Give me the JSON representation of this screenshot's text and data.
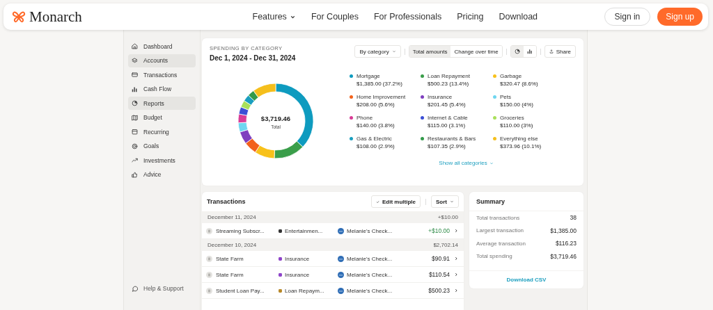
{
  "nav": {
    "brand": "Monarch",
    "links": [
      {
        "label": "Features",
        "dropdown": true
      },
      {
        "label": "For Couples",
        "dropdown": false
      },
      {
        "label": "For Professionals",
        "dropdown": false
      },
      {
        "label": "Pricing",
        "dropdown": false
      },
      {
        "label": "Download",
        "dropdown": false
      }
    ],
    "sign_in": "Sign in",
    "sign_up": "Sign up"
  },
  "sidebar": {
    "items": [
      {
        "label": "Dashboard",
        "selected": false
      },
      {
        "label": "Accounts",
        "selected": true
      },
      {
        "label": "Transactions",
        "selected": false
      },
      {
        "label": "Cash Flow",
        "selected": false
      },
      {
        "label": "Reports",
        "selected": true
      },
      {
        "label": "Budget",
        "selected": false
      },
      {
        "label": "Recurring",
        "selected": false
      },
      {
        "label": "Goals",
        "selected": false
      },
      {
        "label": "Investments",
        "selected": false
      },
      {
        "label": "Advice",
        "selected": false
      }
    ],
    "footer": "Help & Support"
  },
  "spending": {
    "eyebrow": "SPENDING BY CATEGORY",
    "date_range": "Dec 1, 2024 - Dec 31, 2024",
    "group_by": "By category",
    "modes": [
      {
        "label": "Total amounts",
        "selected": true
      },
      {
        "label": "Change over time",
        "selected": false
      }
    ],
    "views": [
      {
        "selected": true
      },
      {
        "selected": false
      }
    ],
    "share": "Share",
    "total": "$3,719.46",
    "total_label": "Total",
    "chart_data": {
      "type": "donut",
      "categories": [
        "Mortgage",
        "Loan Repayment",
        "Garbage",
        "Home Improvement",
        "Insurance",
        "Pets",
        "Phone",
        "Internet & Cable",
        "Groceries",
        "Gas & Electric",
        "Restaurants & Bars",
        "Everything else"
      ],
      "values": [
        37.2,
        13.4,
        8.6,
        5.6,
        5.4,
        4,
        3.8,
        3.1,
        3,
        2.9,
        2.9,
        10.1
      ]
    },
    "legend": [
      {
        "amount": "$1,385.00 (37.2%)",
        "color": "#0e9bbf"
      },
      {
        "amount": "$500.23 (13.4%)",
        "color": "#3a9e4a"
      },
      {
        "amount": "$320.47 (8.6%)",
        "color": "#f8c11a"
      },
      {
        "amount": "$208.00 (5.6%)",
        "color": "#f2621c"
      },
      {
        "amount": "$201.45 (5.4%)",
        "color": "#7f3fbf"
      },
      {
        "amount": "$150.00 (4%)",
        "color": "#6fd6f0"
      },
      {
        "amount": "$140.00 (3.8%)",
        "color": "#d93d96"
      },
      {
        "amount": "$115.00 (3.1%)",
        "color": "#3b4fd6"
      },
      {
        "amount": "$110.00 (3%)",
        "color": "#a9e05a"
      },
      {
        "amount": "$108.00 (2.9%)",
        "color": "#1a9fbf"
      },
      {
        "amount": "$107.35 (2.9%)",
        "color": "#329a4a"
      },
      {
        "amount": "$373.96 (10.1%)",
        "color": "#f5bf1c"
      }
    ],
    "show_all": "Show all categories"
  },
  "transactions": {
    "title": "Transactions",
    "edit": "Edit multiple",
    "sort": "Sort",
    "groups": [
      {
        "date": "December 11, 2024",
        "total": "+$10.00",
        "rows": [
          {
            "merchant": "Streaming Subscr...",
            "category": {
              "label": "Entertainmen...",
              "color": "#333333"
            },
            "account": "Melanie's Check...",
            "amount": "+$10.00",
            "positive": true
          }
        ]
      },
      {
        "date": "December 10, 2024",
        "total": "$2,702.14",
        "rows": [
          {
            "merchant": "State Farm",
            "category": {
              "label": "Insurance",
              "color": "#8e44c9"
            },
            "account": "Melanie's Check...",
            "amount": "$90.91",
            "positive": false
          },
          {
            "merchant": "State Farm",
            "category": {
              "label": "Insurance",
              "color": "#8e44c9"
            },
            "account": "Melanie's Check...",
            "amount": "$110.54",
            "positive": false
          },
          {
            "merchant": "Student Loan Pay...",
            "category": {
              "label": "Loan Repaym...",
              "color": "#b8892a"
            },
            "account": "Melanie's Check...",
            "amount": "$500.23",
            "positive": false
          }
        ]
      }
    ]
  },
  "summary": {
    "title": "Summary",
    "rows": [
      {
        "label": "Total transactions",
        "value": "38"
      },
      {
        "label": "Largest transaction",
        "value": "$1,385.00"
      },
      {
        "label": "Average transaction",
        "value": "$116.23"
      },
      {
        "label": "Total spending",
        "value": "$3,719.46"
      }
    ],
    "download": "Download CSV"
  }
}
